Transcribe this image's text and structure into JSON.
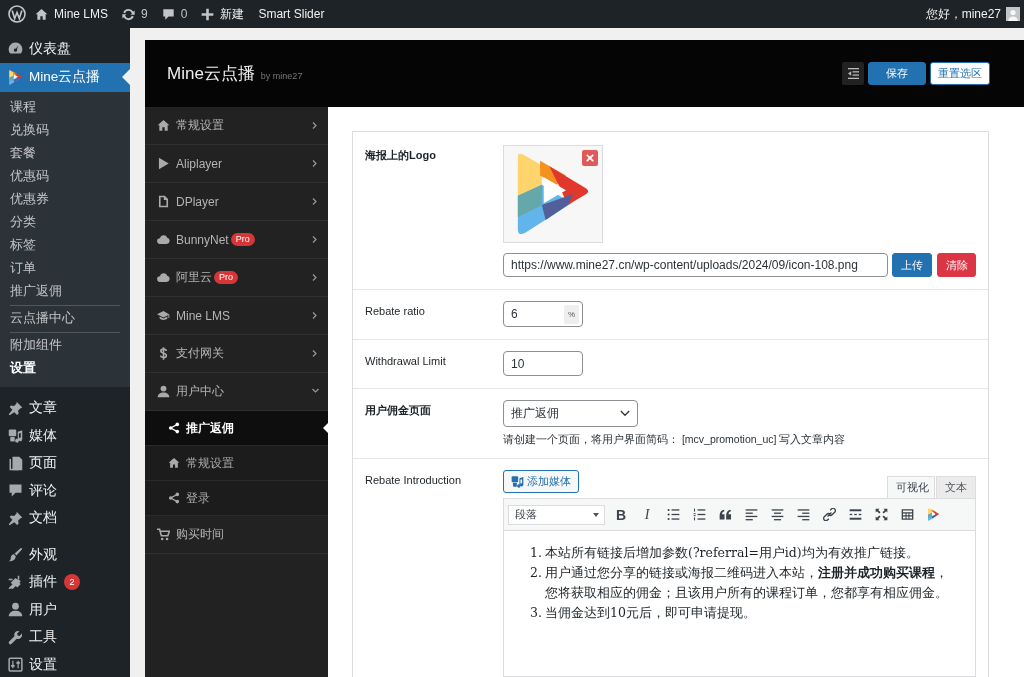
{
  "admin_bar": {
    "items": [
      {
        "kind": "logo"
      },
      {
        "kind": "site",
        "label": "Mine LMS"
      },
      {
        "kind": "updates",
        "label": "9"
      },
      {
        "kind": "comments",
        "label": "0"
      },
      {
        "kind": "new",
        "label": "新建"
      },
      {
        "kind": "plain",
        "label": "Smart Slider"
      }
    ],
    "greeting": "您好，mine27"
  },
  "admin_menu": {
    "groups": [
      {
        "items": [
          {
            "kind": "dashboard",
            "label": "仪表盘",
            "selected": false
          },
          {
            "kind": "video",
            "label": "Mine云点播",
            "selected": true,
            "submenu": [
              {
                "items": [
                  {
                    "label": "课程",
                    "selected": false
                  },
                  {
                    "label": "兑换码",
                    "selected": false
                  },
                  {
                    "label": "套餐",
                    "selected": false
                  },
                  {
                    "label": "优惠码",
                    "selected": false
                  },
                  {
                    "label": "优惠券",
                    "selected": false
                  },
                  {
                    "label": "分类",
                    "selected": false
                  },
                  {
                    "label": "标签",
                    "selected": false
                  },
                  {
                    "label": "订单",
                    "selected": false
                  },
                  {
                    "label": "推广返佣",
                    "selected": false
                  }
                ]
              },
              {
                "items": [
                  {
                    "label": "云点播中心",
                    "selected": false
                  }
                ]
              },
              {
                "items": [
                  {
                    "label": "附加组件",
                    "selected": false
                  },
                  {
                    "label": "设置",
                    "selected": true
                  }
                ]
              }
            ]
          },
          {
            "kind": "posts",
            "label": "文章",
            "selected": false
          },
          {
            "kind": "media",
            "label": "媒体",
            "selected": false
          },
          {
            "kind": "pages",
            "label": "页面",
            "selected": false
          },
          {
            "kind": "comments",
            "label": "评论",
            "selected": false
          },
          {
            "kind": "posts",
            "label": "文档",
            "selected": false
          }
        ]
      },
      {
        "items": [
          {
            "kind": "appearance",
            "label": "外观",
            "selected": false
          },
          {
            "kind": "plugins",
            "label": "插件",
            "badge": "2",
            "selected": false
          },
          {
            "kind": "users",
            "label": "用户",
            "selected": false
          },
          {
            "kind": "tools",
            "label": "工具",
            "selected": false
          },
          {
            "kind": "settings",
            "label": "设置",
            "selected": false
          }
        ]
      }
    ]
  },
  "panel": {
    "title": "Mine云点播",
    "byline": "by mine27",
    "buttons": [
      {
        "kind": "primary",
        "label": "保存"
      },
      {
        "kind": "outline",
        "label": "重置选区"
      }
    ]
  },
  "settings_nav": [
    {
      "kind": "home",
      "label": "常规设置",
      "expanded": false
    },
    {
      "kind": "play",
      "label": "Aliplayer",
      "expanded": false
    },
    {
      "kind": "file",
      "label": "DPlayer",
      "expanded": false
    },
    {
      "kind": "cloud",
      "label": "BunnyNet",
      "badge": "Pro",
      "expanded": false
    },
    {
      "kind": "cloud",
      "label": "阿里云",
      "badge": "Pro",
      "expanded": false
    },
    {
      "kind": "cap",
      "label": "Mine LMS",
      "expanded": false
    },
    {
      "kind": "dollar",
      "label": "支付网关",
      "expanded": false
    },
    {
      "kind": "user",
      "label": "用户中心",
      "expanded": true,
      "children": [
        {
          "kind": "share",
          "label": "推广返佣",
          "selected": true
        },
        {
          "kind": "home",
          "label": "常规设置",
          "selected": false
        },
        {
          "kind": "share",
          "label": "登录",
          "selected": false
        }
      ]
    },
    {
      "kind": "cart",
      "label": "购买时间"
    }
  ],
  "form": {
    "rows": [
      {
        "kind": "image",
        "label": "海报上的Logo",
        "bold": true,
        "url": "https://www.mine27.cn/wp-content/uploads/2024/09/icon-108.png",
        "buttons": [
          {
            "kind": "primary",
            "label": "上传"
          },
          {
            "kind": "danger",
            "label": "清除"
          }
        ]
      },
      {
        "kind": "input",
        "label": "Rebate ratio",
        "bold": false,
        "value": "6",
        "suffix": "%"
      },
      {
        "kind": "input",
        "label": "Withdrawal Limit",
        "bold": false,
        "value": "10"
      },
      {
        "kind": "select",
        "label": "用户佣金页面",
        "bold": true,
        "value": "推广返佣",
        "description": "请创建一个页面，将用户界面简码： [mcv_promotion_uc] 写入文章内容"
      },
      {
        "kind": "editor",
        "label": "Rebate Introduction",
        "bold": false,
        "media_button": "添加媒体",
        "tabs": [
          {
            "label": "可视化",
            "selected": true
          },
          {
            "label": "文本",
            "selected": false
          }
        ],
        "format": "段落",
        "toolbar": [
          {
            "kind": "bold",
            "label": "B"
          },
          {
            "kind": "italic",
            "label": "I"
          },
          {
            "kind": "bullets"
          },
          {
            "kind": "numbers"
          },
          {
            "kind": "quote"
          },
          {
            "kind": "align-left"
          },
          {
            "kind": "align-center"
          },
          {
            "kind": "align-right"
          },
          {
            "kind": "link"
          },
          {
            "kind": "more"
          },
          {
            "kind": "fullscreen"
          },
          {
            "kind": "grid"
          },
          {
            "kind": "logo"
          }
        ],
        "content": [
          {
            "number": "1.",
            "text": "本站所有链接后增加参数(?referral=用户id)均为有效推广链接。"
          },
          {
            "number": "2.",
            "text": "用户通过您分享的链接或海报二维码进入本站，**注册并成功购买课程**，您将获取相应的佣金；且该用户所有的课程订单，您都享有相应佣金。"
          },
          {
            "number": "3.",
            "text": "当佣金达到10元后，即可申请提现。"
          }
        ]
      }
    ]
  }
}
